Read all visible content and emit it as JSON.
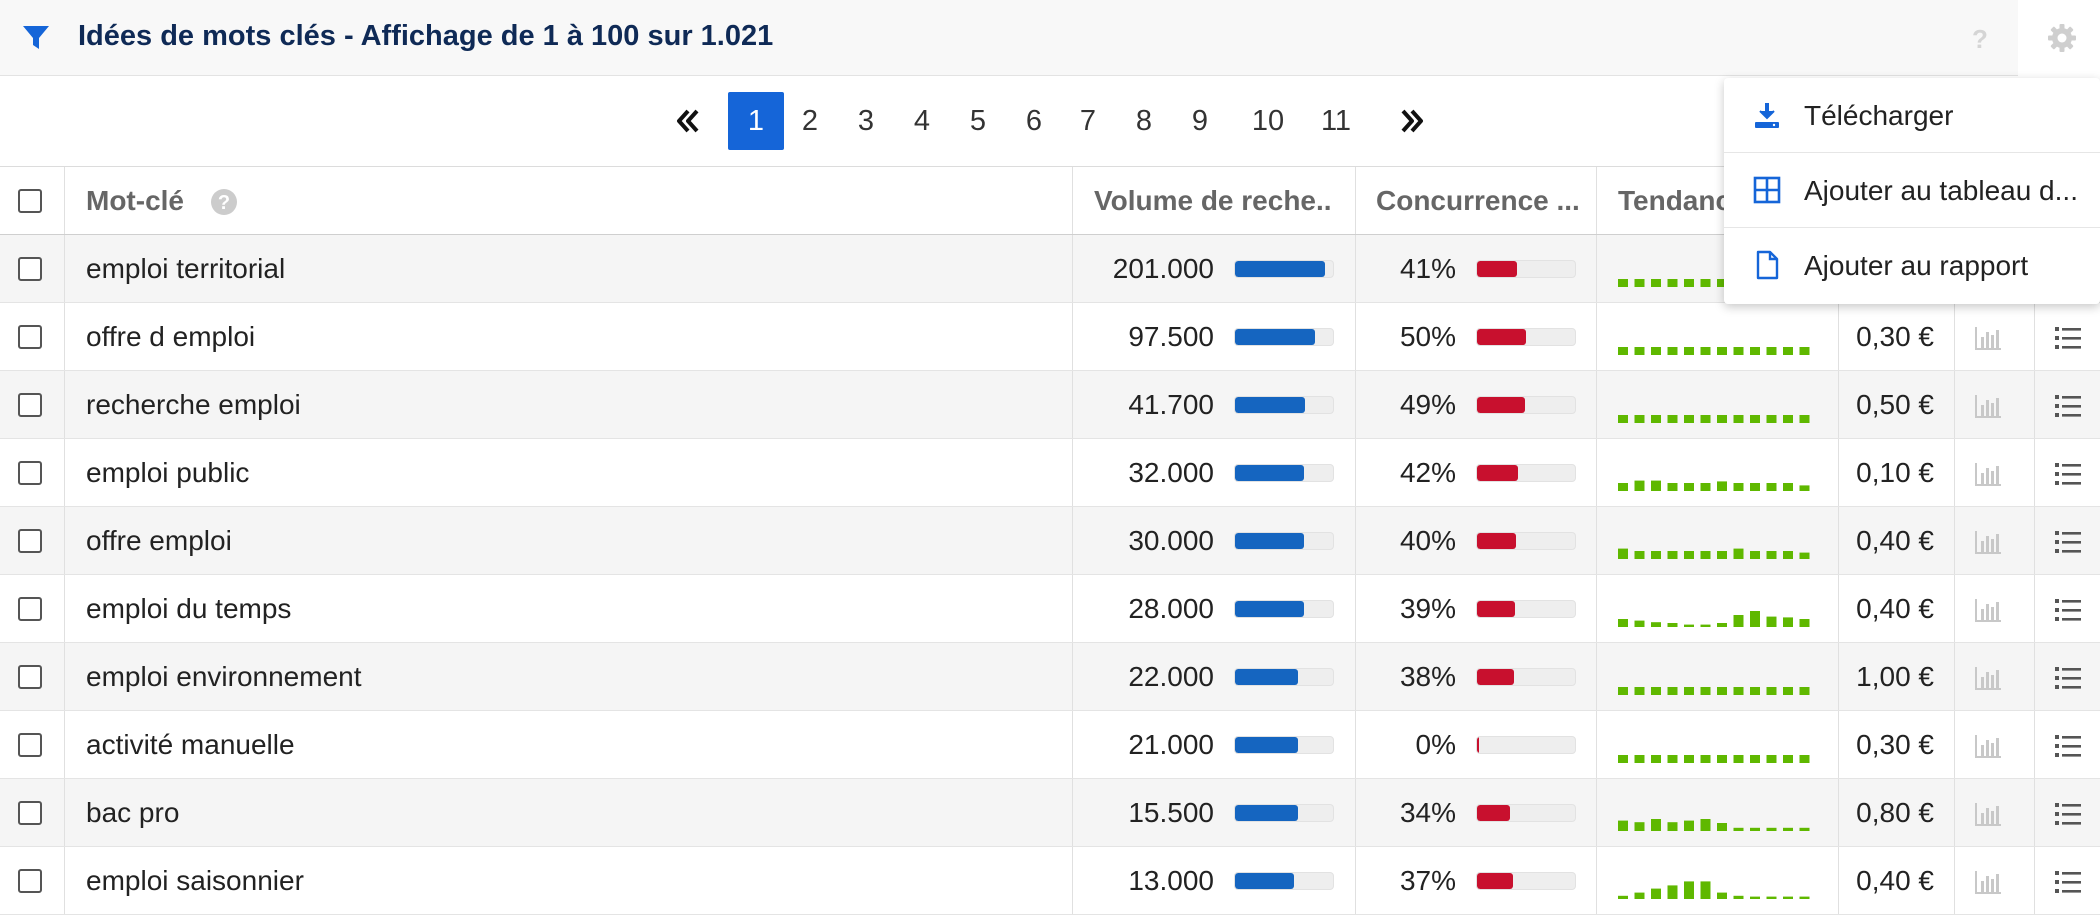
{
  "header": {
    "title": "Idées de mots clés - Affichage de 1 à 100 sur 1.021",
    "help_glyph": "?",
    "colors": {
      "title": "#0f2a56",
      "accent": "#1565d8"
    }
  },
  "pagination": {
    "pages": [
      "1",
      "2",
      "3",
      "4",
      "5",
      "6",
      "7",
      "8",
      "9",
      "10",
      "11"
    ],
    "active": "1"
  },
  "table": {
    "columns": {
      "keyword": "Mot-clé",
      "volume": "Volume de reche...",
      "competition": "Concurrence ...",
      "trend": "Tendance"
    },
    "rows": [
      {
        "keyword": "emploi territorial",
        "volume": "201.000",
        "volume_fill": 0.92,
        "competition": "41%",
        "comp_fill": 0.41,
        "cpc": "",
        "trend": [
          1,
          1,
          1,
          1,
          1,
          1,
          1,
          1,
          1,
          1,
          1,
          1
        ]
      },
      {
        "keyword": "offre d emploi",
        "volume": "97.500",
        "volume_fill": 0.82,
        "competition": "50%",
        "comp_fill": 0.5,
        "cpc": "0,30 €",
        "trend": [
          1,
          1,
          1,
          1,
          1,
          1,
          1,
          1,
          1,
          1,
          1,
          1
        ]
      },
      {
        "keyword": "recherche emploi",
        "volume": "41.700",
        "volume_fill": 0.71,
        "competition": "49%",
        "comp_fill": 0.49,
        "cpc": "0,50 €",
        "trend": [
          1,
          1,
          1,
          1,
          1,
          1,
          1,
          1,
          1,
          1,
          1,
          1
        ]
      },
      {
        "keyword": "emploi public",
        "volume": "32.000",
        "volume_fill": 0.7,
        "competition": "42%",
        "comp_fill": 0.42,
        "cpc": "0,10 €",
        "trend": [
          1,
          1.3,
          1.3,
          1,
          1,
          1,
          1.2,
          1,
          1,
          1,
          1,
          0.7
        ]
      },
      {
        "keyword": "offre emploi",
        "volume": "30.000",
        "volume_fill": 0.7,
        "competition": "40%",
        "comp_fill": 0.4,
        "cpc": "0,40 €",
        "trend": [
          1.3,
          1,
          1,
          1,
          1,
          1,
          1,
          1.3,
          1,
          1,
          1,
          0.8
        ]
      },
      {
        "keyword": "emploi du temps",
        "volume": "28.000",
        "volume_fill": 0.7,
        "competition": "39%",
        "comp_fill": 0.39,
        "cpc": "0,40 €",
        "trend": [
          1,
          0.8,
          0.6,
          0.5,
          0.3,
          0.3,
          0.5,
          1.5,
          2,
          1.3,
          1.2,
          1
        ]
      },
      {
        "keyword": "emploi environnement",
        "volume": "22.000",
        "volume_fill": 0.64,
        "competition": "38%",
        "comp_fill": 0.38,
        "cpc": "1,00 €",
        "trend": [
          1,
          1,
          1,
          1,
          1,
          1,
          1,
          1,
          1,
          1,
          1,
          1
        ]
      },
      {
        "keyword": "activité manuelle",
        "volume": "21.000",
        "volume_fill": 0.64,
        "competition": "0%",
        "comp_fill": 0.0,
        "cpc": "0,30 €",
        "trend": [
          1,
          1,
          1,
          1,
          1,
          1,
          1,
          1,
          1,
          1,
          1,
          1
        ]
      },
      {
        "keyword": "bac pro",
        "volume": "15.500",
        "volume_fill": 0.64,
        "competition": "34%",
        "comp_fill": 0.34,
        "cpc": "0,80 €",
        "trend": [
          1.3,
          1.1,
          1.5,
          1.1,
          1.3,
          1.5,
          1,
          0.4,
          0.4,
          0.4,
          0.4,
          0.4
        ]
      },
      {
        "keyword": "emploi saisonnier",
        "volume": "13.000",
        "volume_fill": 0.6,
        "competition": "37%",
        "comp_fill": 0.37,
        "cpc": "0,40 €",
        "trend": [
          0.4,
          0.8,
          1.3,
          1.7,
          2.2,
          2.2,
          0.8,
          0.4,
          0.3,
          0.3,
          0.3,
          0.3
        ]
      }
    ]
  },
  "dropdown": {
    "items": [
      {
        "label": "Télécharger",
        "icon": "download-icon"
      },
      {
        "label": "Ajouter au tableau d...",
        "icon": "table-grid-icon"
      },
      {
        "label": "Ajouter au rapport",
        "icon": "document-icon"
      }
    ]
  },
  "colors": {
    "volume_bar": "#1565c0",
    "competition_bar": "#c8102e",
    "trend_bar": "#5fb800"
  }
}
